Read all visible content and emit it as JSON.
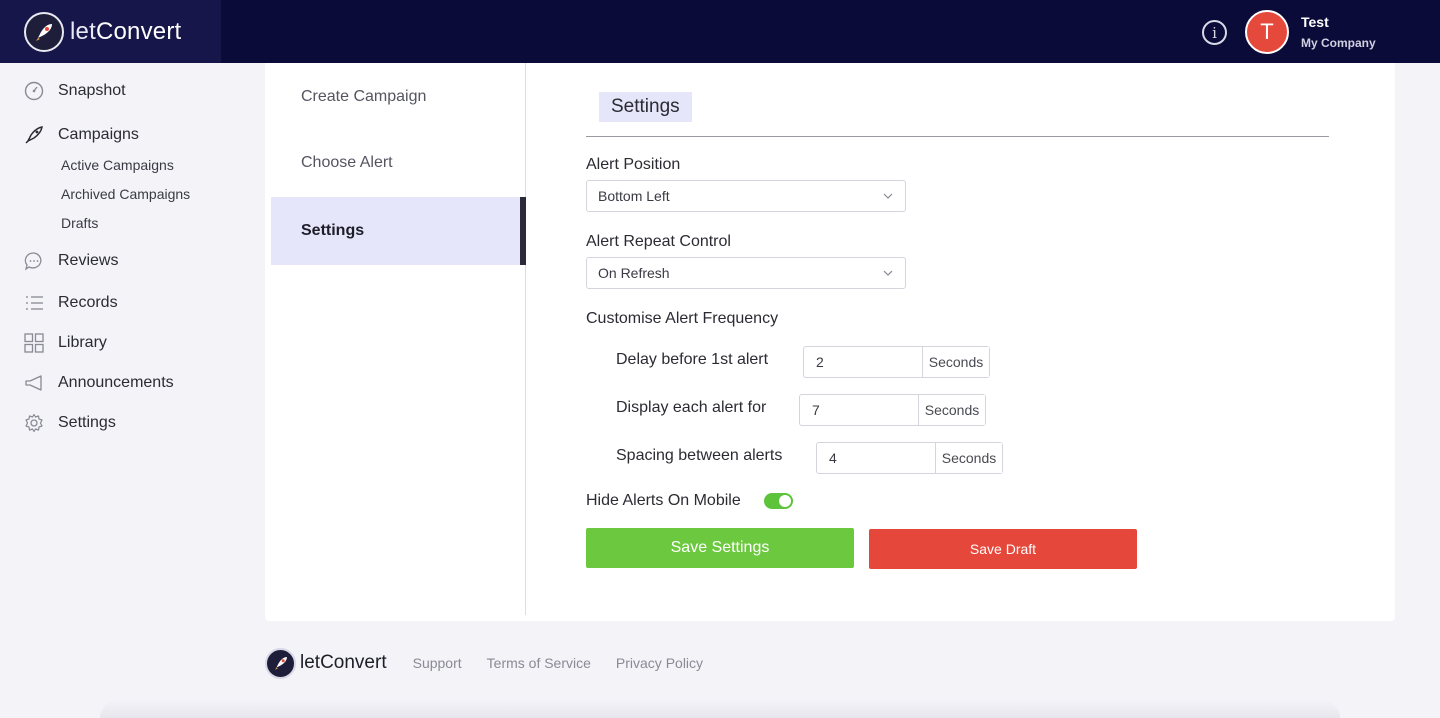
{
  "brand": {
    "name_light": "let",
    "name_bold": "Convert"
  },
  "user": {
    "initial": "T",
    "name": "Test",
    "company": "My Company"
  },
  "sidebar": {
    "items": [
      {
        "label": "Snapshot",
        "icon": "speedometer-icon"
      },
      {
        "label": "Campaigns",
        "icon": "rocket-icon"
      },
      {
        "label": "Reviews",
        "icon": "chat-bubble-icon"
      },
      {
        "label": "Records",
        "icon": "list-icon"
      },
      {
        "label": "Library",
        "icon": "grid-icon"
      },
      {
        "label": "Announcements",
        "icon": "megaphone-icon"
      },
      {
        "label": "Settings",
        "icon": "gear-icon"
      }
    ],
    "campaign_subitems": [
      "Active Campaigns",
      "Archived Campaigns",
      "Drafts"
    ]
  },
  "steps": [
    {
      "label": "Create Campaign",
      "active": false
    },
    {
      "label": "Choose Alert",
      "active": false
    },
    {
      "label": "Settings",
      "active": true
    }
  ],
  "panel": {
    "title": "Settings",
    "alert_position": {
      "label": "Alert Position",
      "value": "Bottom Left"
    },
    "alert_repeat": {
      "label": "Alert Repeat Control",
      "value": "On Refresh"
    },
    "frequency": {
      "label": "Customise Alert Frequency",
      "rows": [
        {
          "label": "Delay before 1st alert",
          "value": "2",
          "unit": "Seconds"
        },
        {
          "label": "Display each alert for",
          "value": "7",
          "unit": "Seconds"
        },
        {
          "label": "Spacing between alerts",
          "value": "4",
          "unit": "Seconds"
        }
      ]
    },
    "hide_mobile": {
      "label": "Hide Alerts On Mobile",
      "on": true
    },
    "save_settings_label": "Save Settings",
    "save_draft_label": "Save Draft"
  },
  "footer": {
    "brand_light": "let",
    "brand_bold": "Convert",
    "links": [
      "Support",
      "Terms of Service",
      "Privacy Policy"
    ]
  },
  "colors": {
    "topbar": "#0b0b3a",
    "accent_lavender": "#e6e6fa",
    "save_green": "#6cc93f",
    "draft_red": "#e5473a",
    "avatar": "#e5493b"
  }
}
